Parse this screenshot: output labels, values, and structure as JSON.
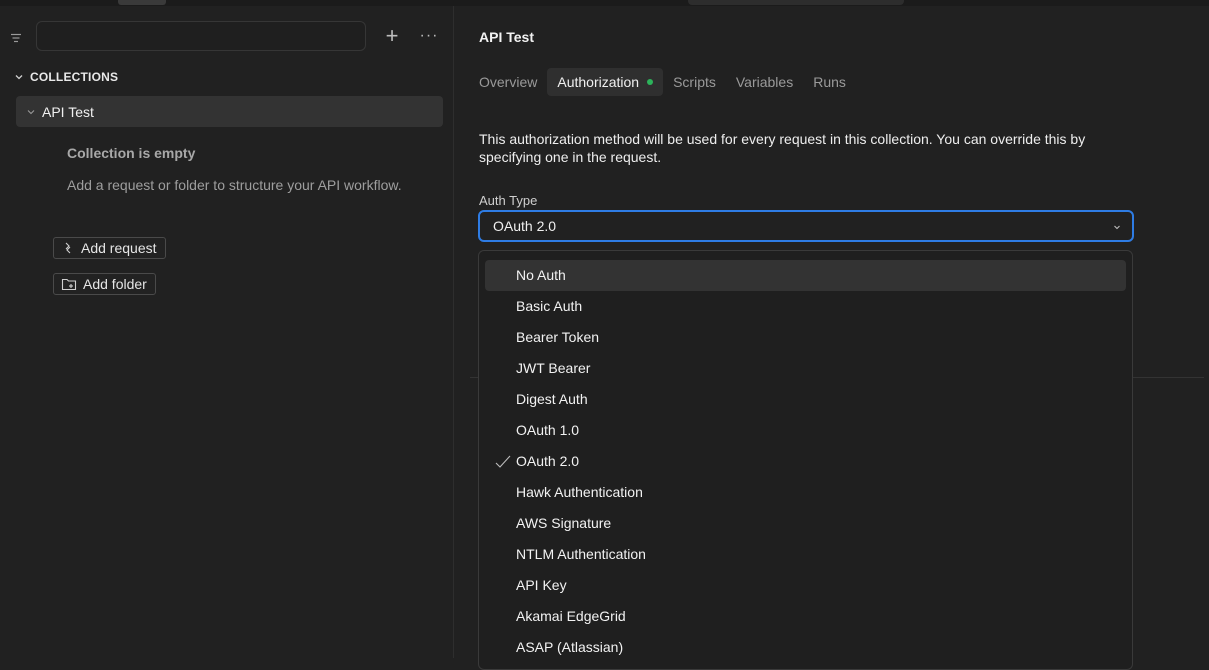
{
  "sidebar": {
    "search_placeholder": "",
    "collections_header": "COLLECTIONS",
    "collection_name": "API Test",
    "empty_title": "Collection is empty",
    "empty_description": "Add a request or folder to structure your API workflow.",
    "add_request_label": "Add request",
    "add_folder_label": "Add folder",
    "plus_label": "+",
    "more_label": "···"
  },
  "main": {
    "title": "API Test",
    "tabs": [
      {
        "label": "Overview",
        "active": false
      },
      {
        "label": "Authorization",
        "active": true
      },
      {
        "label": "Scripts",
        "active": false
      },
      {
        "label": "Variables",
        "active": false
      },
      {
        "label": "Runs",
        "active": false
      }
    ],
    "description": "This authorization method will be used for every request in this collection. You can override this by specifying one in the request.",
    "auth_type_label": "Auth Type",
    "auth_type_value": "OAuth 2.0",
    "options": [
      "No Auth",
      "Basic Auth",
      "Bearer Token",
      "JWT Bearer",
      "Digest Auth",
      "OAuth 1.0",
      "OAuth 2.0",
      "Hawk Authentication",
      "AWS Signature",
      "NTLM Authentication",
      "API Key",
      "Akamai EdgeGrid",
      "ASAP (Atlassian)"
    ],
    "selected_option": "OAuth 2.0",
    "hovered_option": "No Auth"
  },
  "colors": {
    "accent_focus": "#2e7ce4",
    "status_dot": "#2cb35a",
    "background": "#212121"
  }
}
